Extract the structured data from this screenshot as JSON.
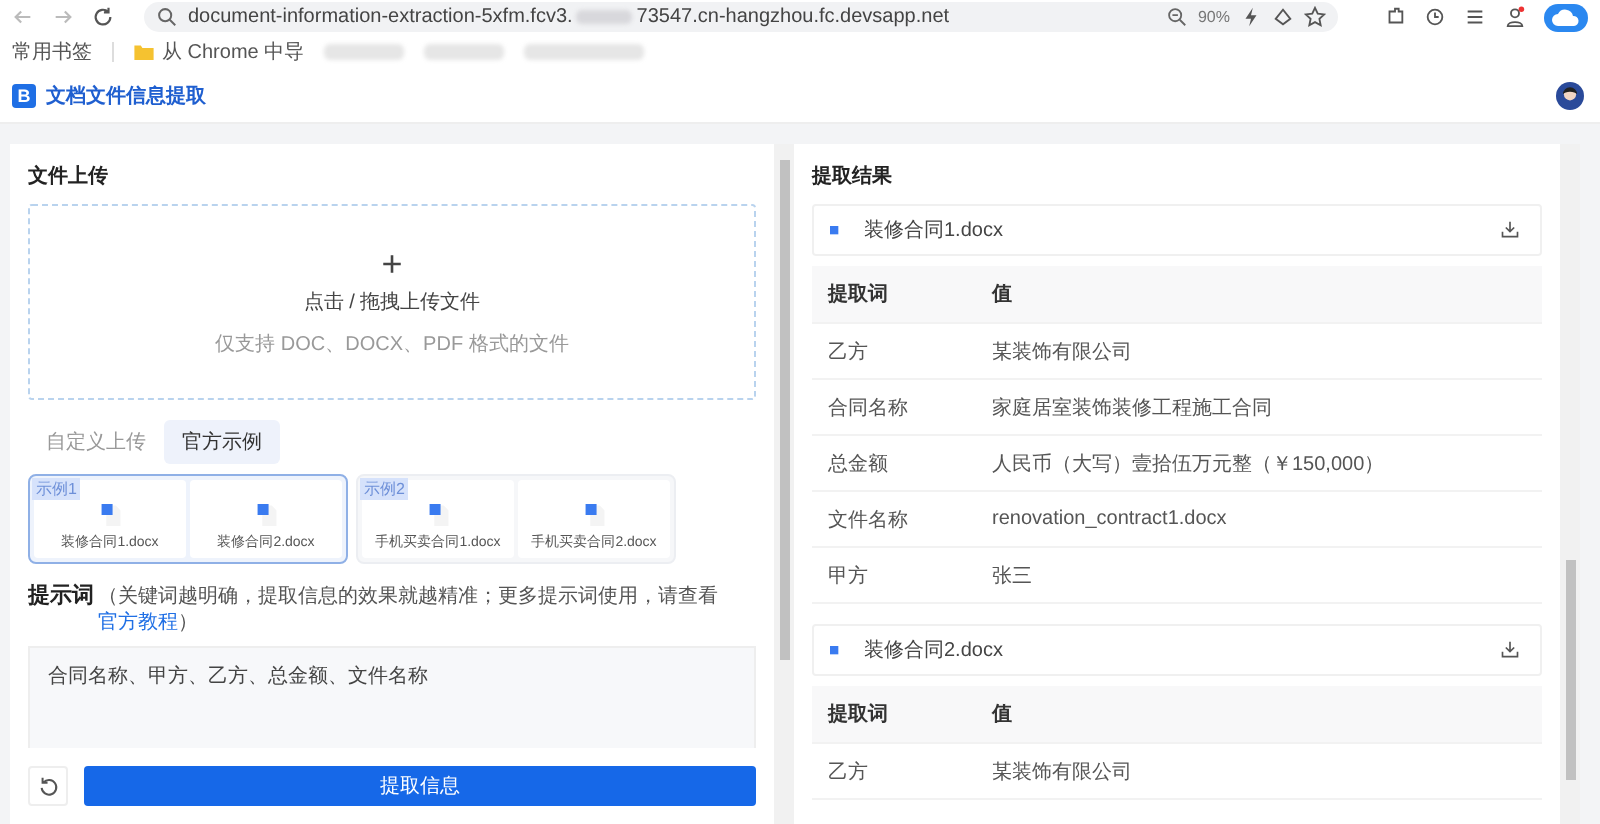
{
  "browser": {
    "url_start": "document-information-extraction-5xfm.fcv3.",
    "url_end": "73547.cn-hangzhou.fc.devsapp.net",
    "zoom": "90%"
  },
  "bookmarks": [
    {
      "label": "常用书签",
      "kind": "text"
    },
    {
      "label": "从 Chrome 中导",
      "kind": "folder"
    }
  ],
  "app": {
    "title": "文档文件信息提取",
    "logo": "B"
  },
  "upload": {
    "heading": "文件上传",
    "plus": "+",
    "action": "点击 / 拖拽上传文件",
    "hint": "仅支持 DOC、DOCX、PDF 格式的文件"
  },
  "tabs": [
    {
      "label": "自定义上传",
      "selected": false
    },
    {
      "label": "官方示例",
      "selected": true
    }
  ],
  "examples": [
    {
      "badge": "示例1",
      "selected": true,
      "files": [
        "装修合同1.docx",
        "装修合同2.docx"
      ]
    },
    {
      "badge": "示例2",
      "selected": false,
      "files": [
        "手机买卖合同1.docx",
        "手机买卖合同2.docx"
      ]
    }
  ],
  "prompt": {
    "label": "提示词",
    "hint_start": "（关键词越明确，提取信息的效果就越精准；更多提示词使用，请查看",
    "link": "官方教程",
    "hint_end": "）",
    "value": "合同名称、甲方、乙方、总金额、文件名称"
  },
  "submit": "提取信息",
  "results": {
    "heading": "提取结果",
    "files": [
      {
        "name": "装修合同1.docx",
        "columns": [
          "提取词",
          "值"
        ],
        "rows": [
          [
            "乙方",
            "某装饰有限公司"
          ],
          [
            "合同名称",
            "家庭居室装饰装修工程施工合同"
          ],
          [
            "总金额",
            "人民币（大写）壹拾伍万元整（￥150,000）"
          ],
          [
            "文件名称",
            "renovation_contract1.docx"
          ],
          [
            "甲方",
            "张三"
          ]
        ]
      },
      {
        "name": "装修合同2.docx",
        "columns": [
          "提取词",
          "值"
        ],
        "rows": [
          [
            "乙方",
            "某装饰有限公司"
          ]
        ]
      }
    ]
  }
}
